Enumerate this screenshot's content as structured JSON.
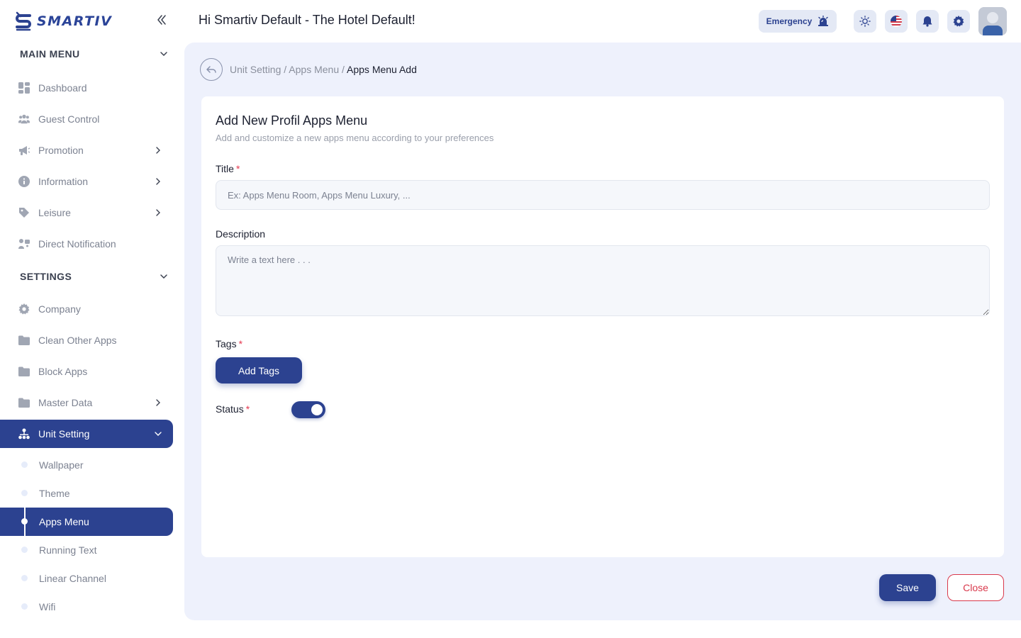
{
  "brand": {
    "name": "SMARTIV"
  },
  "sidebar": {
    "main_menu_title": "MAIN MENU",
    "main_items": [
      {
        "label": "Dashboard",
        "icon": "dashboard-icon",
        "has_children": false
      },
      {
        "label": "Guest Control",
        "icon": "users-icon",
        "has_children": false
      },
      {
        "label": "Promotion",
        "icon": "megaphone-icon",
        "has_children": true
      },
      {
        "label": "Information",
        "icon": "info-icon",
        "has_children": true
      },
      {
        "label": "Leisure",
        "icon": "tag-icon",
        "has_children": true
      },
      {
        "label": "Direct Notification",
        "icon": "notification-icon",
        "has_children": false
      }
    ],
    "settings_title": "SETTINGS",
    "settings_items": [
      {
        "label": "Company",
        "icon": "gear-icon",
        "has_children": false
      },
      {
        "label": "Clean Other Apps",
        "icon": "folder-icon",
        "has_children": false
      },
      {
        "label": "Block Apps",
        "icon": "folder-icon",
        "has_children": false
      },
      {
        "label": "Master Data",
        "icon": "folder-icon",
        "has_children": true
      },
      {
        "label": "Unit Setting",
        "icon": "hierarchy-icon",
        "has_children": true,
        "active": true
      }
    ],
    "unit_setting_subitems": [
      {
        "label": "Wallpaper"
      },
      {
        "label": "Theme"
      },
      {
        "label": "Apps Menu",
        "active": true
      },
      {
        "label": "Running Text"
      },
      {
        "label": "Linear Channel"
      },
      {
        "label": "Wifi"
      }
    ]
  },
  "header": {
    "greeting": "Hi Smartiv Default - The Hotel Default!",
    "emergency_label": "Emergency"
  },
  "breadcrumb": {
    "items": [
      "Unit Setting",
      "Apps Menu"
    ],
    "current": "Apps Menu Add",
    "separator": "/"
  },
  "form": {
    "title": "Add New Profil Apps Menu",
    "subtitle": "Add and customize a new apps menu according to your preferences",
    "title_label": "Title",
    "title_placeholder": "Ex: Apps Menu Room, Apps Menu Luxury, ...",
    "title_value": "",
    "description_label": "Description",
    "description_placeholder": "Write a text here . . .",
    "description_value": "",
    "tags_label": "Tags",
    "add_tags_label": "Add Tags",
    "status_label": "Status",
    "status_on": true,
    "required_mark": "*"
  },
  "actions": {
    "save_label": "Save",
    "close_label": "Close"
  },
  "colors": {
    "primary": "#2c4290",
    "danger": "#d9394c",
    "main_bg": "#eef1fc"
  }
}
